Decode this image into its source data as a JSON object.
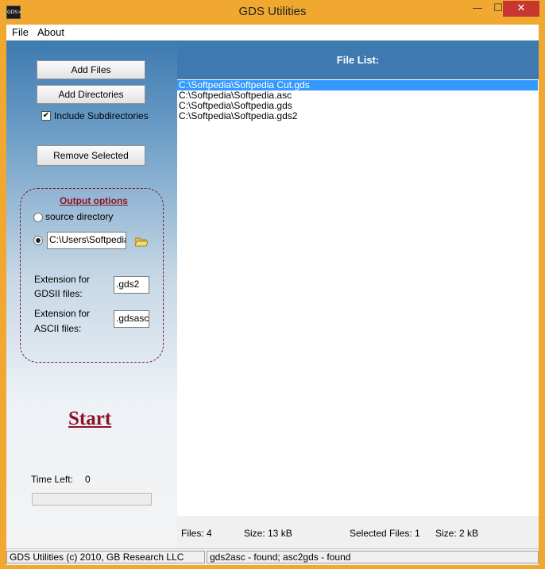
{
  "window": {
    "title": "GDS Utilities",
    "icon_label": "GDS>",
    "minimize_glyph": "—",
    "maximize_glyph": "☐",
    "close_glyph": "✕",
    "accent_color": "#f0a830"
  },
  "menu": {
    "items": [
      {
        "label": "File"
      },
      {
        "label": "About"
      }
    ]
  },
  "left_panel": {
    "add_files_label": "Add Files",
    "add_directories_label": "Add Directories",
    "include_subdirectories_label": "Include Subdirectories",
    "include_subdirectories_checked": true,
    "remove_selected_label": "Remove Selected"
  },
  "output_options": {
    "title": "Output options",
    "source_directory_label": "source directory",
    "source_directory_selected": false,
    "custom_dir_selected": true,
    "custom_dir_value": "C:\\Users\\Softpedia\\",
    "gdsii_ext_label_line1": "Extension for",
    "gdsii_ext_label_line2": "GDSII files:",
    "gdsii_ext_value": ".gds2",
    "ascii_ext_label_line1": "Extension for",
    "ascii_ext_label_line2": "ASCII files:",
    "ascii_ext_value": ".gdsasc"
  },
  "start_label": "Start",
  "time_left": {
    "label": "Time Left:",
    "value": "0",
    "progress": 0
  },
  "file_list": {
    "title": "File List:",
    "files": [
      {
        "path": "C:\\Softpedia\\Softpedia Cut.gds",
        "selected": true
      },
      {
        "path": "C:\\Softpedia\\Softpedia.asc",
        "selected": false
      },
      {
        "path": "C:\\Softpedia\\Softpedia.gds",
        "selected": false
      },
      {
        "path": "C:\\Softpedia\\Softpedia.gds2",
        "selected": false
      }
    ]
  },
  "summary": {
    "files": "Files: 4",
    "size": "Size: 13 kB",
    "selected_files": "Selected Files: 1",
    "selected_size": "Size: 2 kB"
  },
  "statusbar": {
    "left": "GDS Utilities (c) 2010, GB Research LLC",
    "right": "gds2asc - found; asc2gds - found"
  }
}
